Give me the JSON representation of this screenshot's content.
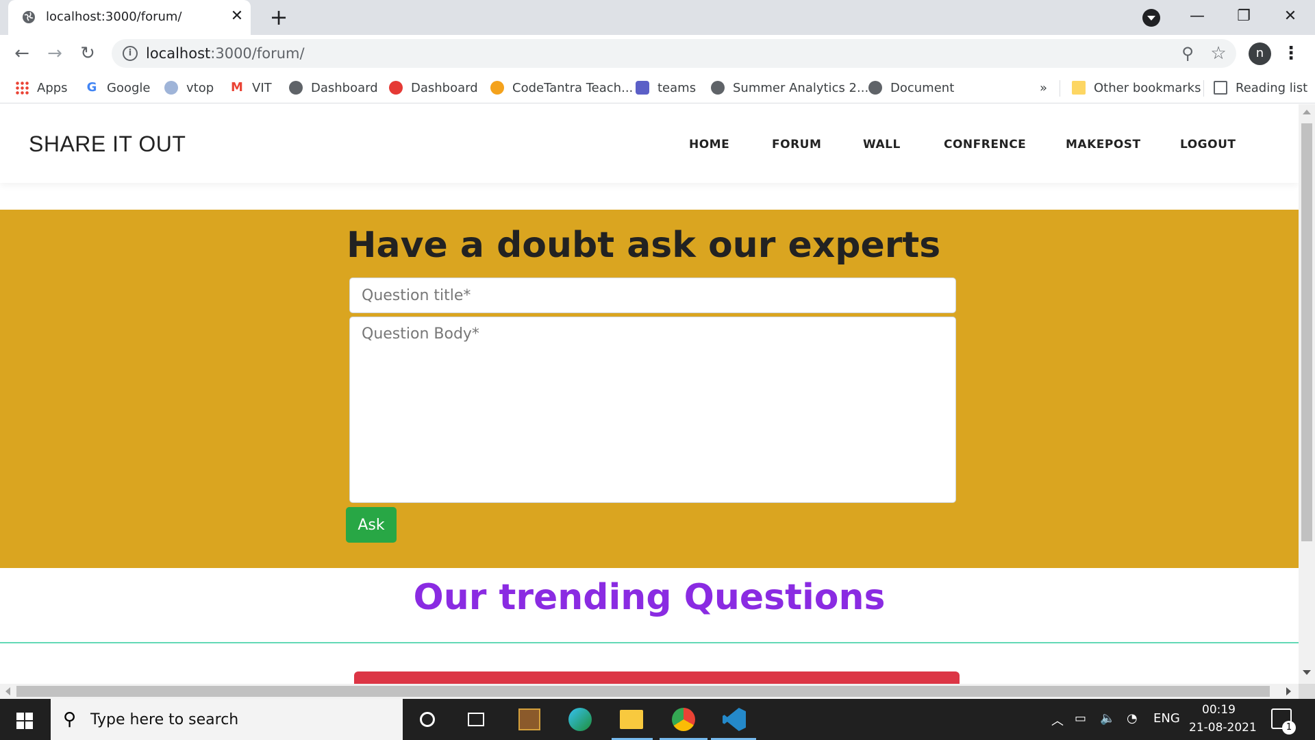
{
  "browser": {
    "tab_title": "localhost:3000/forum/",
    "new_tab_symbol": "+",
    "close_symbol": "✕",
    "url_host": "localhost",
    "url_path": ":3000/forum/",
    "profile_initial": "n",
    "window_controls": {
      "minimize": "—",
      "restore": "❐",
      "close": "✕"
    },
    "bookmarks": [
      {
        "label": "Apps",
        "icon": "apps-grid-icon"
      },
      {
        "label": "Google",
        "icon": "google-icon"
      },
      {
        "label": "vtop",
        "icon": "vtop-icon"
      },
      {
        "label": "VIT",
        "icon": "gmail-icon"
      },
      {
        "label": "Dashboard",
        "icon": "globe-icon"
      },
      {
        "label": "Dashboard",
        "icon": "dashboard-icon"
      },
      {
        "label": "CodeTantra Teach...",
        "icon": "codetantra-icon"
      },
      {
        "label": "teams",
        "icon": "teams-icon"
      },
      {
        "label": "Summer Analytics 2...",
        "icon": "globe-icon"
      },
      {
        "label": "Document",
        "icon": "globe-icon"
      }
    ],
    "overflow_symbol": "»",
    "other_bookmarks": "Other bookmarks",
    "reading_list": "Reading list"
  },
  "site": {
    "brand": "SHARE IT OUT",
    "nav": [
      "HOME",
      "FORUM",
      "WALL",
      "CONFRENCE",
      "MAKEPOST",
      "LOGOUT"
    ]
  },
  "hero": {
    "title": "Have a doubt ask our experts",
    "title_placeholder": "Question title*",
    "body_placeholder": "Question Body*",
    "ask_label": "Ask"
  },
  "trending": {
    "heading": "Our trending Questions"
  },
  "colors": {
    "hero_bg": "#daa520",
    "ask_button": "#28a745",
    "trending_heading": "#8a2be2",
    "card_header": "#dc3545"
  },
  "taskbar": {
    "search_placeholder": "Type here to search",
    "language": "ENG",
    "time": "00:19",
    "date": "21-08-2021",
    "notification_count": "1"
  }
}
